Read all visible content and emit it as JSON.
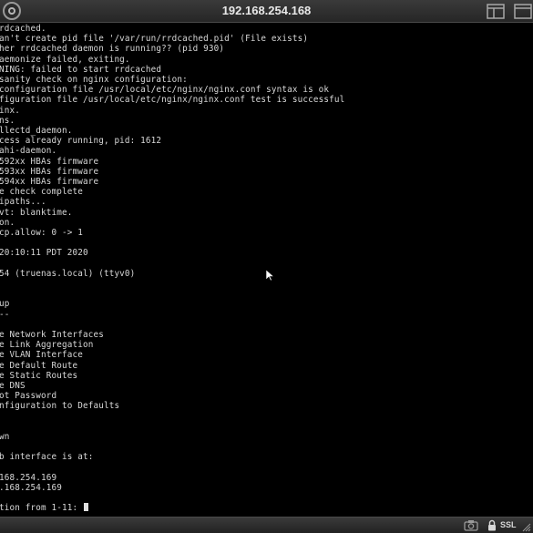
{
  "window": {
    "title": "192.168.254.168",
    "ssl_label": "SSL"
  },
  "icons": {
    "power": "power-button-icon",
    "layout": "window-layout-icon",
    "fullscreen": "fullscreen-icon",
    "camera": "screenshot-camera-icon",
    "lock": "lock-icon",
    "resize": "resize-grip-icon"
  },
  "console": {
    "lines": [
      {
        "text": "rdcached."
      },
      {
        "text": "an't create pid file '/var/run/rrdcached.pid' (File exists)"
      },
      {
        "text": "her rrdcached daemon is running?? (pid 930)"
      },
      {
        "text": "aemonize failed, exiting."
      },
      {
        "text": "NING: failed to start rrdcached"
      },
      {
        "text": "sanity check on nginx configuration:"
      },
      {
        "text": "configuration file /usr/local/etc/nginx/nginx.conf syntax is ok"
      },
      {
        "text": "figuration file /usr/local/etc/nginx/nginx.conf test is successful"
      },
      {
        "text": "inx."
      },
      {
        "text": "ns."
      },
      {
        "text": "llectd_daemon."
      },
      {
        "text": "cess already running, pid: 1612"
      },
      {
        "text": "ahi-daemon."
      },
      {
        "text": "592xx HBAs firmware"
      },
      {
        "text": "593xx HBAs firmware"
      },
      {
        "text": "594xx HBAs firmware"
      },
      {
        "text": "e check complete"
      },
      {
        "text": "ipaths..."
      },
      {
        "text": "vt: blanktime."
      },
      {
        "text": "on."
      },
      {
        "text": "cp.allow: 0 -> 1"
      },
      {
        "text": ""
      },
      {
        "text": "20:10:11 PDT 2020"
      },
      {
        "text": ""
      },
      {
        "text": "54 (truenas.local) (ttyv0)"
      },
      {
        "text": ""
      },
      {
        "text": ""
      },
      {
        "text": "up"
      },
      {
        "text": "--"
      },
      {
        "text": ""
      },
      {
        "text": "e Network Interfaces"
      },
      {
        "text": "e Link Aggregation"
      },
      {
        "text": "e VLAN Interface"
      },
      {
        "text": "e Default Route"
      },
      {
        "text": "e Static Routes"
      },
      {
        "text": "e DNS"
      },
      {
        "text": "ot Password"
      },
      {
        "text": "nfiguration to Defaults"
      },
      {
        "text": ""
      },
      {
        "text": ""
      },
      {
        "text": "wn"
      },
      {
        "text": ""
      },
      {
        "text": "b interface is at:"
      },
      {
        "text": ""
      },
      {
        "text": "168.254.169"
      },
      {
        "text": ".168.254.169"
      },
      {
        "text": ""
      },
      {
        "text": "tion from 1-11: "
      }
    ]
  }
}
